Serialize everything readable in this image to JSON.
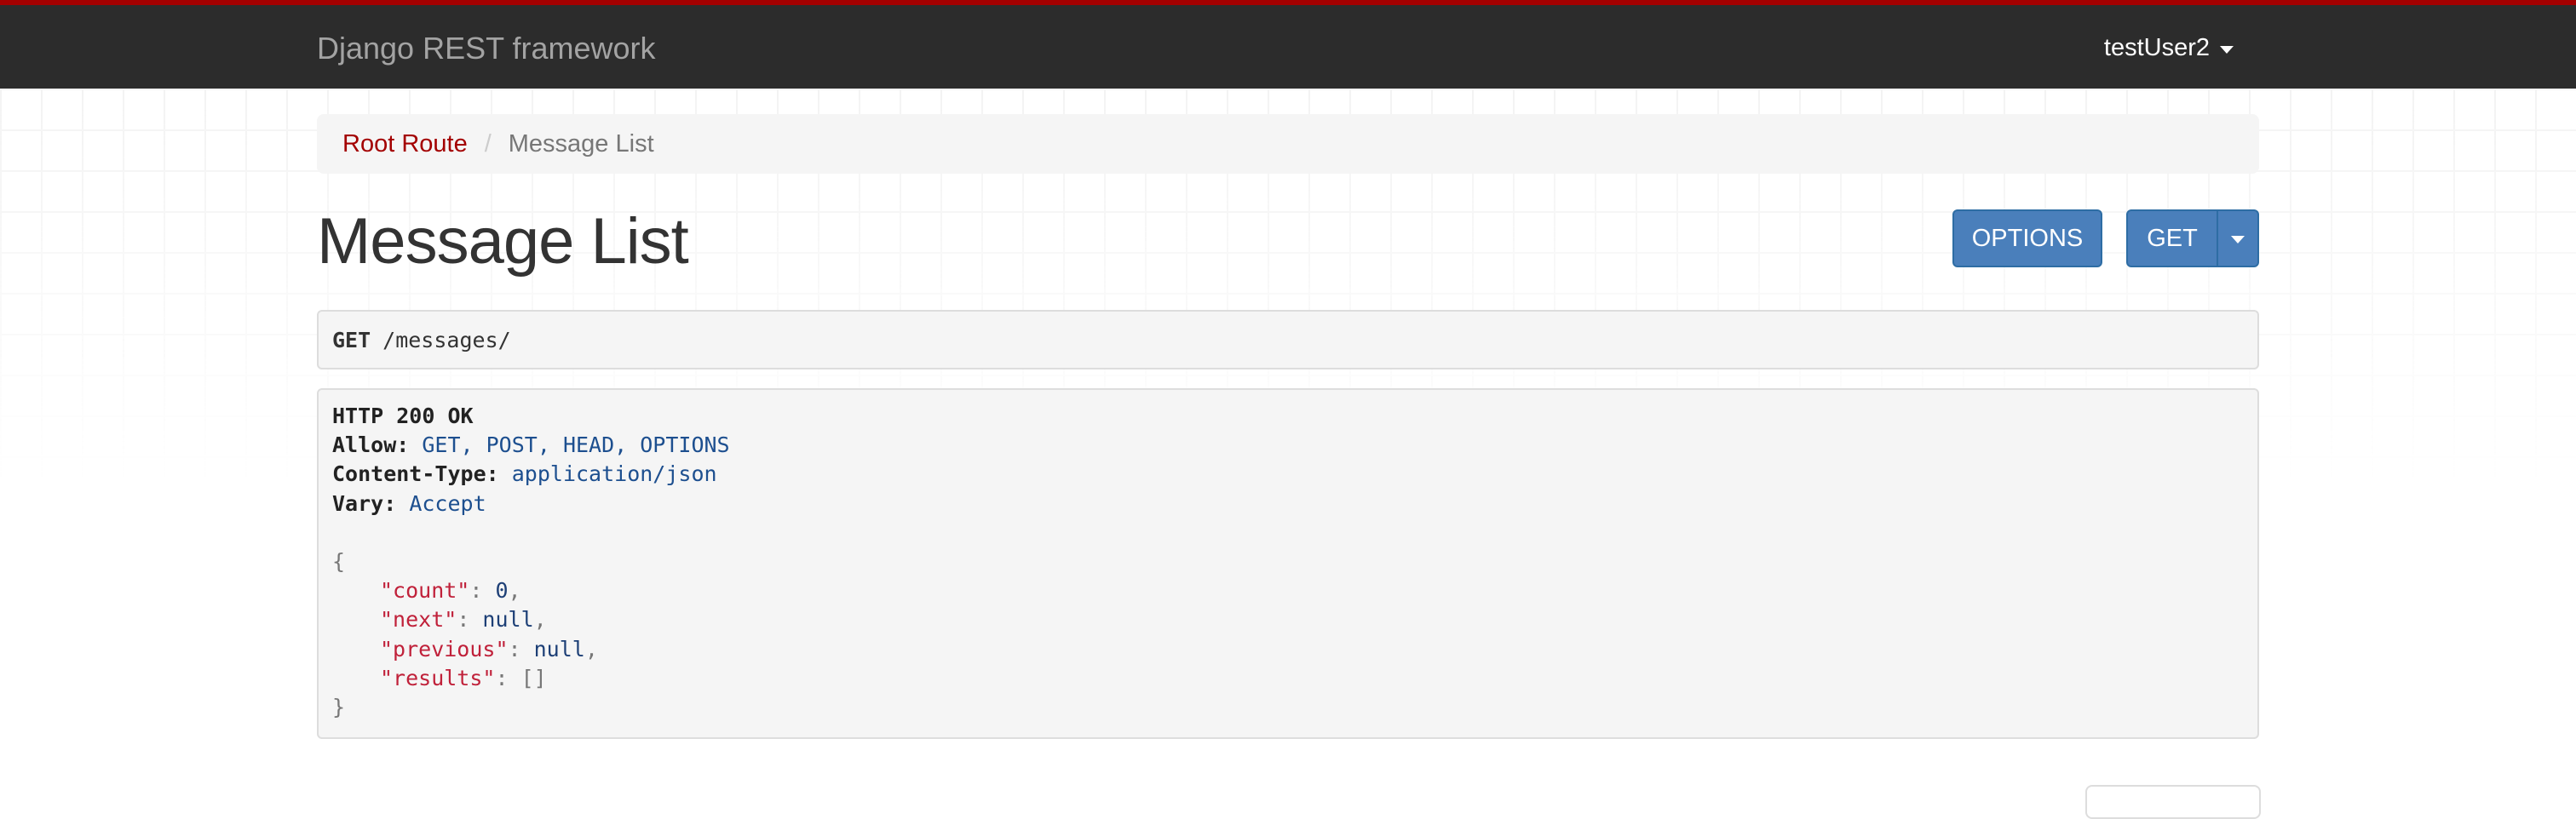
{
  "navbar": {
    "brand": "Django REST framework",
    "user": "testUser2"
  },
  "breadcrumb": {
    "items": [
      {
        "label": "Root Route",
        "active": false
      },
      {
        "label": "Message List",
        "active": true
      }
    ],
    "separator": "/"
  },
  "page": {
    "title": "Message List"
  },
  "toolbar": {
    "options_label": "OPTIONS",
    "get_label": "GET"
  },
  "request": {
    "method": "GET",
    "path": "/messages/"
  },
  "response": {
    "status_line": "HTTP 200 OK",
    "headers": [
      {
        "key": "Allow:",
        "value": "GET, POST, HEAD, OPTIONS"
      },
      {
        "key": "Content-Type:",
        "value": "application/json"
      },
      {
        "key": "Vary:",
        "value": "Accept"
      }
    ],
    "body": {
      "open": "{",
      "close": "}",
      "fields": [
        {
          "key": "\"count\"",
          "value": "0",
          "trail": ","
        },
        {
          "key": "\"next\"",
          "value": "null",
          "trail": ","
        },
        {
          "key": "\"previous\"",
          "value": "null",
          "trail": ","
        },
        {
          "key": "\"results\"",
          "value": "[]",
          "trail": ""
        }
      ]
    }
  },
  "colors": {
    "navbar_bg": "#2c2c2c",
    "navbar_accent": "#a30000",
    "link": "#a30000",
    "button": "#4a7fbb",
    "json_key": "#c0213a",
    "json_literal": "#1d3f76",
    "header_value": "#1d4f8f"
  }
}
